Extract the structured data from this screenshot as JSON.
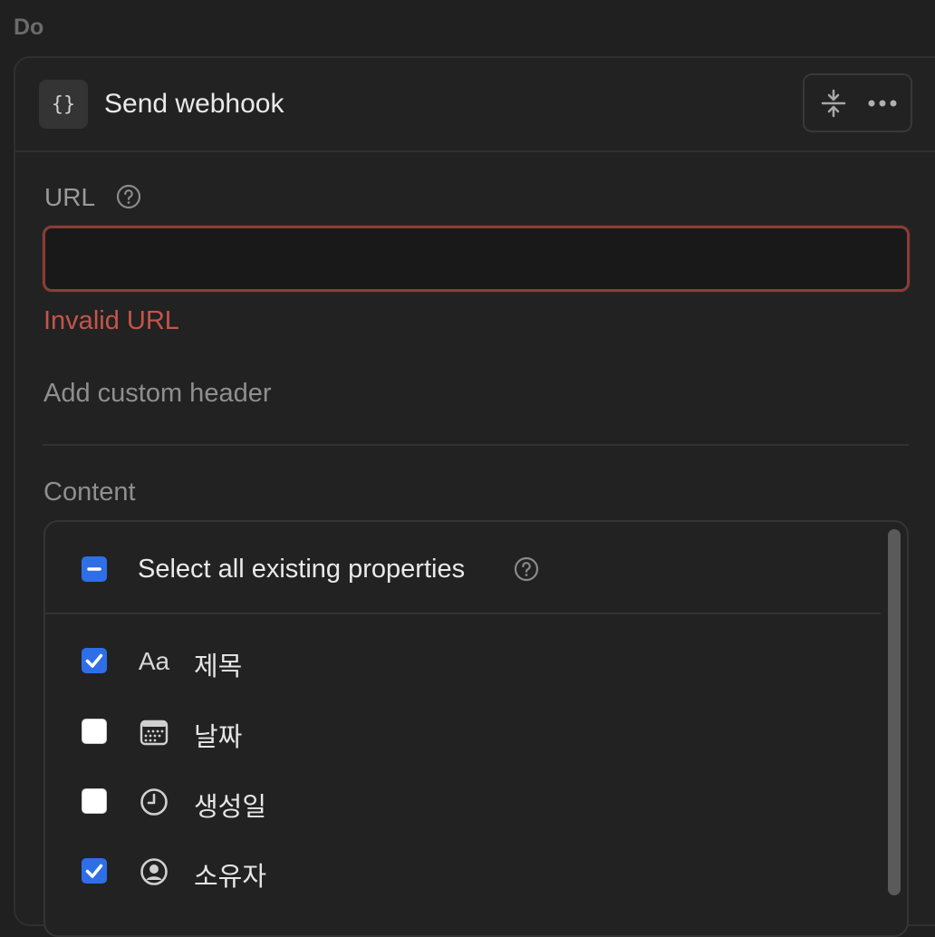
{
  "section_label": "Do",
  "action": {
    "icon": "braces-icon",
    "icon_glyph": "{}",
    "title": "Send webhook"
  },
  "url_field": {
    "label": "URL",
    "value": "",
    "placeholder": "",
    "error": "Invalid URL"
  },
  "custom_header_link": "Add custom header",
  "content": {
    "label": "Content",
    "select_all": {
      "label": "Select all existing properties",
      "state": "partial"
    },
    "properties": [
      {
        "label": "제목",
        "icon": "text-aa-icon",
        "icon_glyph": "Aa",
        "checked": true
      },
      {
        "label": "날짜",
        "icon": "calendar-icon",
        "checked": false
      },
      {
        "label": "생성일",
        "icon": "clock-icon",
        "checked": false
      },
      {
        "label": "소유자",
        "icon": "person-circle-icon",
        "checked": true
      }
    ]
  },
  "colors": {
    "background": "#202020",
    "error": "#c4554b",
    "checkbox_accent": "#2e6fe8"
  }
}
